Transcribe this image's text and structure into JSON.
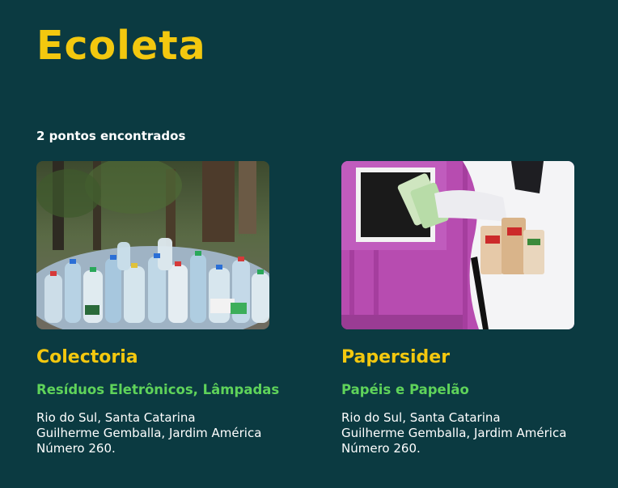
{
  "header": {
    "logo_text": "Ecoleta"
  },
  "results": {
    "count_text": "2 pontos encontrados"
  },
  "points": [
    {
      "image_icon": "plastic-bottles-photo",
      "name": "Colectoria",
      "categories": "Resíduos Eletrônicos, Lâmpadas",
      "address_line1": "Rio do Sul, Santa Catarina",
      "address_line2": "Guilherme Gemballa, Jardim América",
      "address_line3": "Número 260."
    },
    {
      "image_icon": "paper-recycling-photo",
      "name": "Papersider",
      "categories": "Papéis e Papelão",
      "address_line1": "Rio do Sul, Santa Catarina",
      "address_line2": "Guilherme Gemballa, Jardim América",
      "address_line3": "Número 260."
    }
  ],
  "colors": {
    "background": "#0b3a41",
    "accent_yellow": "#f3c80f",
    "accent_green": "#5fd35a"
  }
}
